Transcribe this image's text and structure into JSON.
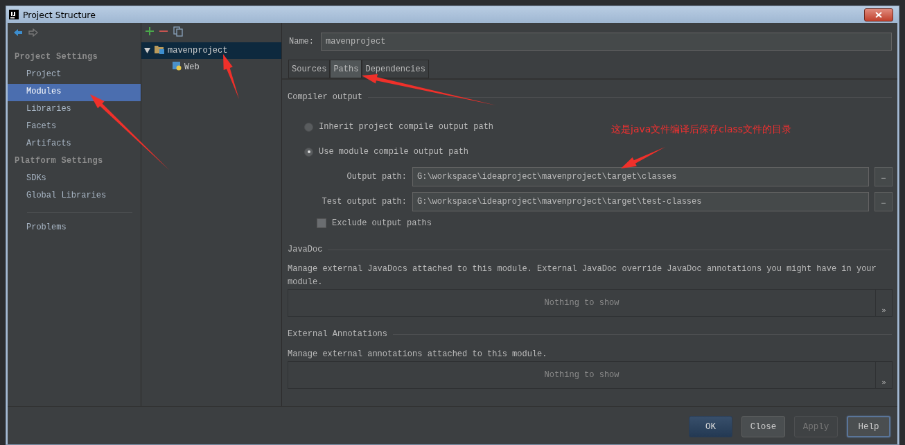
{
  "window": {
    "title": "Project Structure"
  },
  "sidebar": {
    "sections": [
      {
        "heading": "Project Settings",
        "items": [
          {
            "label": "Project",
            "selected": false
          },
          {
            "label": "Modules",
            "selected": true
          },
          {
            "label": "Libraries",
            "selected": false
          },
          {
            "label": "Facets",
            "selected": false
          },
          {
            "label": "Artifacts",
            "selected": false
          }
        ]
      },
      {
        "heading": "Platform Settings",
        "items": [
          {
            "label": "SDKs",
            "selected": false
          },
          {
            "label": "Global Libraries",
            "selected": false
          }
        ]
      }
    ],
    "extra_items": [
      {
        "label": "Problems",
        "selected": false
      }
    ]
  },
  "tree": {
    "items": [
      {
        "label": "mavenproject",
        "expanded": true,
        "selected": true,
        "children": [
          {
            "label": "Web",
            "selected": false
          }
        ]
      }
    ]
  },
  "name_field": {
    "label": "Name:",
    "value": "mavenproject"
  },
  "tabs": [
    {
      "label": "Sources",
      "selected": false
    },
    {
      "label": "Paths",
      "selected": true
    },
    {
      "label": "Dependencies",
      "selected": false
    }
  ],
  "compiler_output": {
    "heading": "Compiler output",
    "options": [
      {
        "label": "Inherit project compile output path",
        "selected": false
      },
      {
        "label": "Use module compile output path",
        "selected": true
      }
    ],
    "paths": [
      {
        "label": "Output path:",
        "value": "G:\\workspace\\ideaproject\\mavenproject\\target\\classes",
        "button": "…"
      },
      {
        "label": "Test output path:",
        "value": "G:\\workspace\\ideaproject\\mavenproject\\target\\test-classes",
        "button": "…"
      }
    ],
    "exclude": {
      "label": "Exclude output paths",
      "checked": false
    }
  },
  "sections": [
    {
      "heading": "JavaDoc",
      "description": "Manage external JavaDocs attached to this module. External JavaDoc override JavaDoc annotations you might have in your module.",
      "empty_text": "Nothing to show",
      "corner": "»"
    },
    {
      "heading": "External Annotations",
      "description": "Manage external annotations attached to this module.",
      "empty_text": "Nothing to show",
      "corner": "»"
    }
  ],
  "buttons": [
    {
      "label": "OK",
      "kind": "default"
    },
    {
      "label": "Close",
      "kind": "normal"
    },
    {
      "label": "Apply",
      "kind": "disabled"
    },
    {
      "label": "Help",
      "kind": "focused"
    }
  ],
  "annotation": {
    "text": "这是java文件编译后保存class文件的目录"
  }
}
